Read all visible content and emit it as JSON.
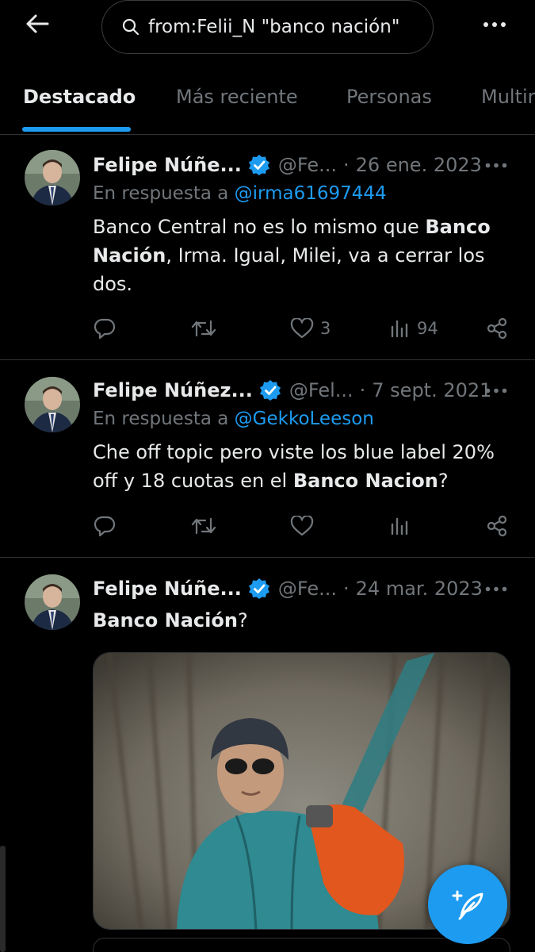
{
  "search": {
    "query": "from:Felii_N \"banco nación\""
  },
  "tabs": [
    "Destacado",
    "Más reciente",
    "Personas",
    "Multir"
  ],
  "tweets": [
    {
      "name": "Felipe Núñe...",
      "handle": "@Fe...",
      "date": "26 ene. 2023",
      "reply_prefix": "En respuesta a ",
      "reply_to": "@irma61697444",
      "text_parts": [
        "Banco Central no es lo mismo que ",
        "Banco Nación",
        ", Irma. Igual, Milei, va a cerrar los dos."
      ],
      "likes": "3",
      "views": "94"
    },
    {
      "name": "Felipe Núñez...",
      "handle": "@Fel...",
      "date": "7 sept. 2021",
      "reply_prefix": "En respuesta a ",
      "reply_to": "@GekkoLeeson",
      "text_parts": [
        "Che off topic pero viste los blue label 20% off y 18 cuotas en el ",
        "Banco Nacion",
        "?"
      ]
    },
    {
      "name": "Felipe Núñe...",
      "handle": "@Fe...",
      "date": "24 mar. 2023",
      "text_parts": [
        "Banco Nación",
        "?"
      ]
    }
  ],
  "colors": {
    "accent": "#1d9bf0",
    "muted": "#71767b",
    "text": "#e7e9ea",
    "divider": "#2f3336"
  },
  "icons": [
    "back-arrow-icon",
    "search-icon",
    "more-icon",
    "verified-badge-icon",
    "reply-icon",
    "retweet-icon",
    "like-icon",
    "views-icon",
    "share-icon",
    "compose-icon"
  ]
}
